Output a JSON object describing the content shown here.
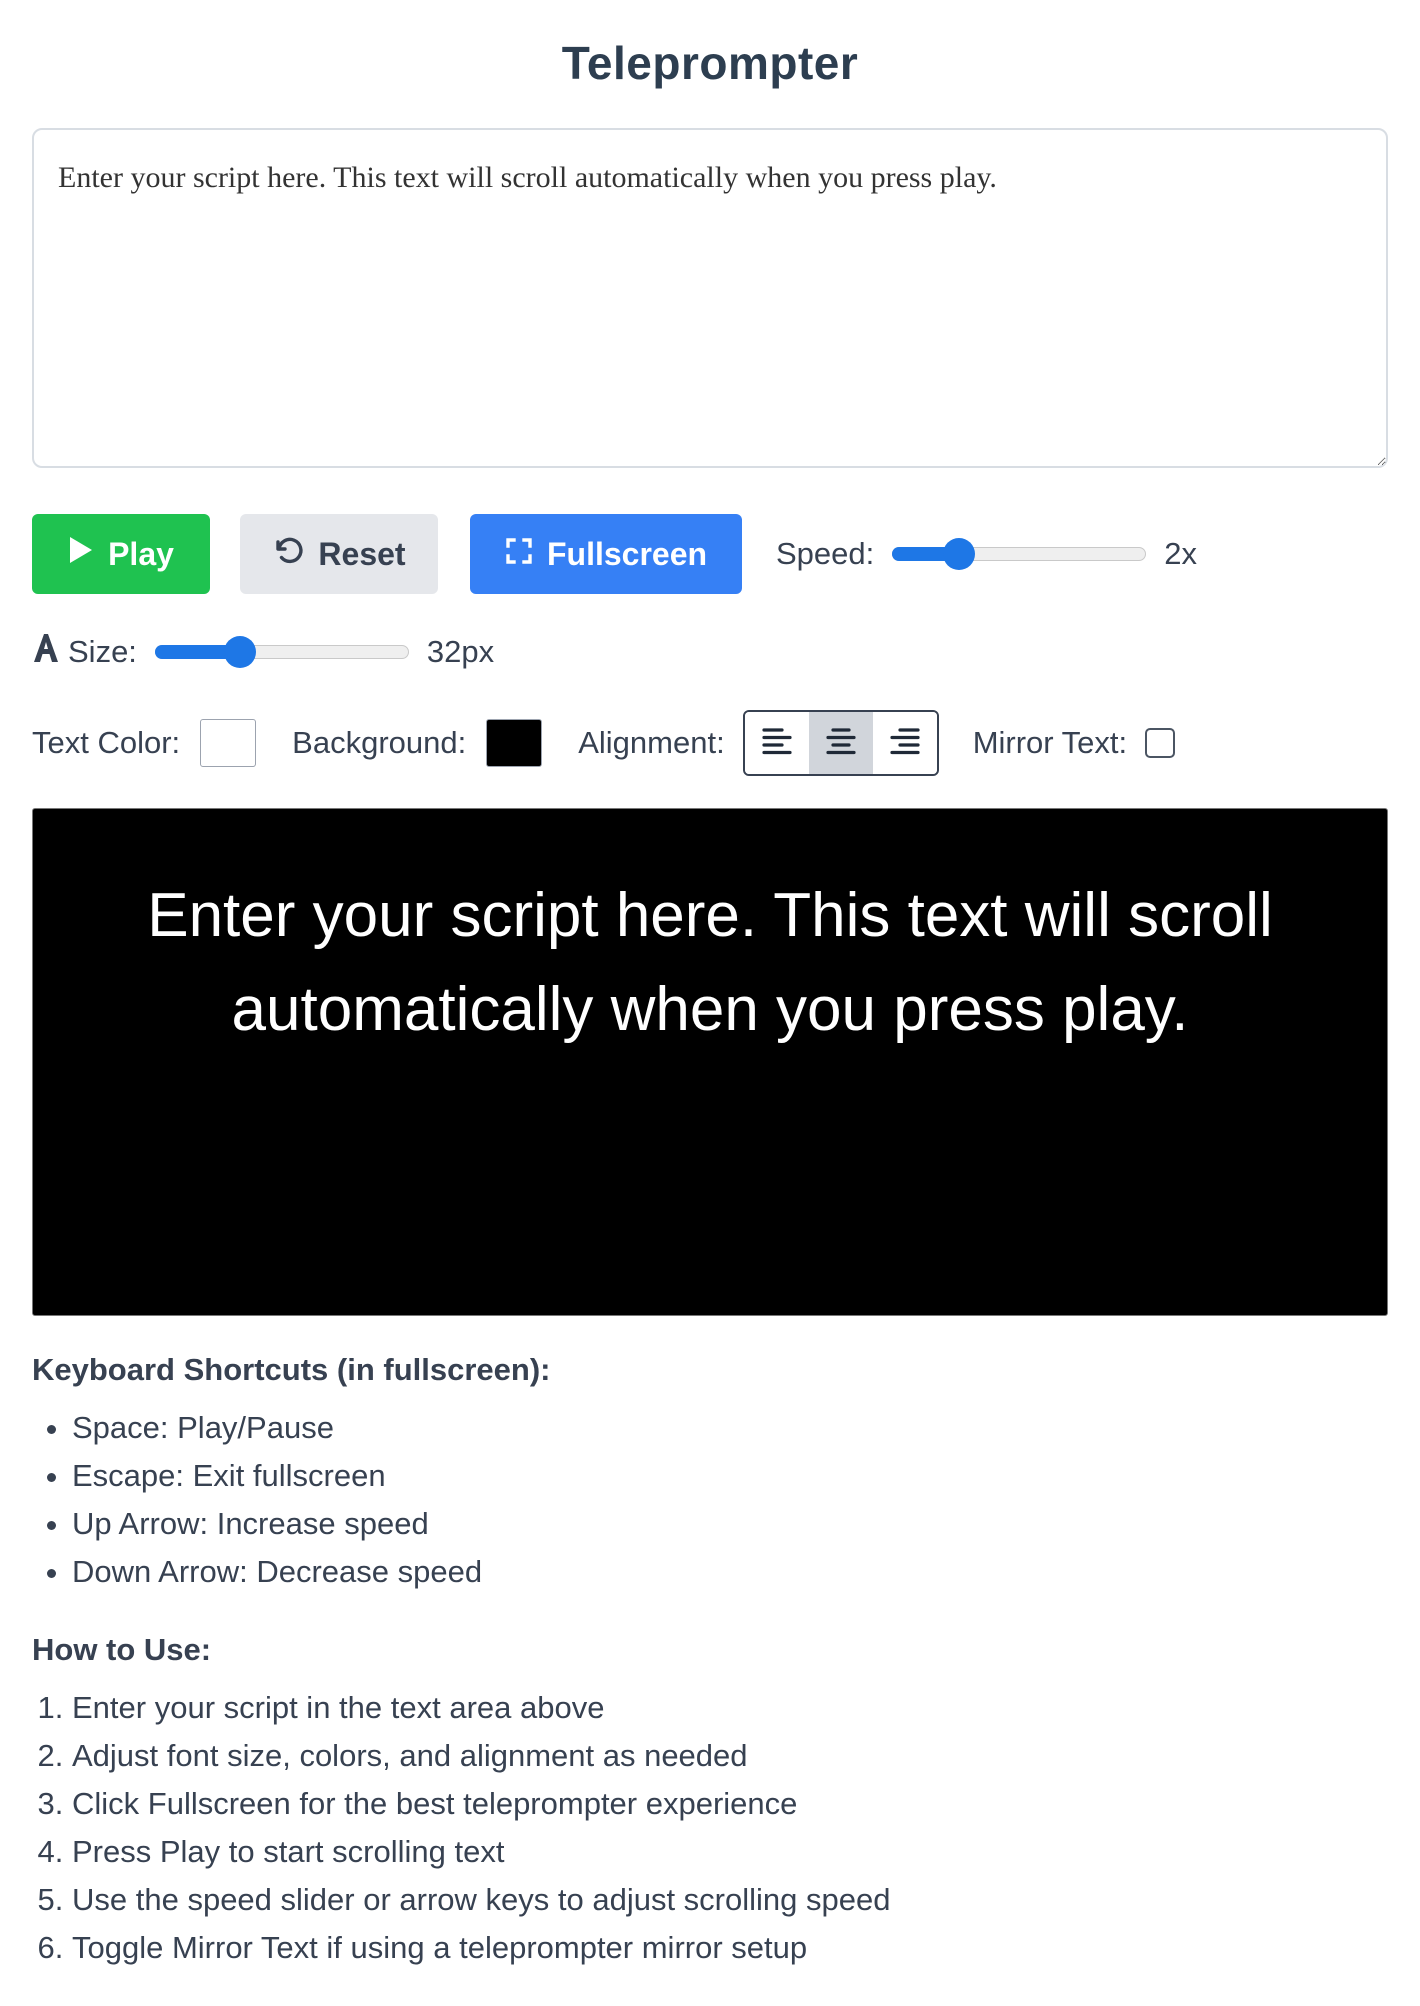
{
  "header": {
    "title": "Teleprompter"
  },
  "script_input": {
    "value": "Enter your script here. This text will scroll automatically when you press play."
  },
  "controls": {
    "play_label": "Play",
    "reset_label": "Reset",
    "fullscreen_label": "Fullscreen",
    "speed_label": "Speed:",
    "speed_value": "2x",
    "speed_fraction": 0.23,
    "size_label": "Size:",
    "size_value": "32px",
    "size_fraction": 0.31,
    "text_color_label": "Text Color:",
    "text_color": "#ffffff",
    "background_label": "Background:",
    "background_color": "#000000",
    "alignment_label": "Alignment:",
    "alignment_selected": "center",
    "mirror_label": "Mirror Text:",
    "mirror_checked": false
  },
  "prompter": {
    "text": "Enter your script here. This text will scroll automatically when you press play."
  },
  "shortcuts": {
    "title": "Keyboard Shortcuts (in fullscreen):",
    "items": [
      "Space: Play/Pause",
      "Escape: Exit fullscreen",
      "Up Arrow: Increase speed",
      "Down Arrow: Decrease speed"
    ]
  },
  "how_to": {
    "title": "How to Use:",
    "items": [
      "Enter your script in the text area above",
      "Adjust font size, colors, and alignment as needed",
      "Click Fullscreen for the best teleprompter experience",
      "Press Play to start scrolling text",
      "Use the speed slider or arrow keys to adjust scrolling speed",
      "Toggle Mirror Text if using a teleprompter mirror setup"
    ]
  },
  "icons": {
    "play": "play-icon",
    "reset": "undo-icon",
    "fullscreen": "expand-icon",
    "font": "font-icon",
    "align_left": "align-left-icon",
    "align_center": "align-center-icon",
    "align_right": "align-right-icon"
  },
  "colors": {
    "play_button": "#1fc250",
    "fullscreen_button": "#3680f5",
    "slider_accent": "#1e77e6",
    "title": "#2d3e50"
  }
}
